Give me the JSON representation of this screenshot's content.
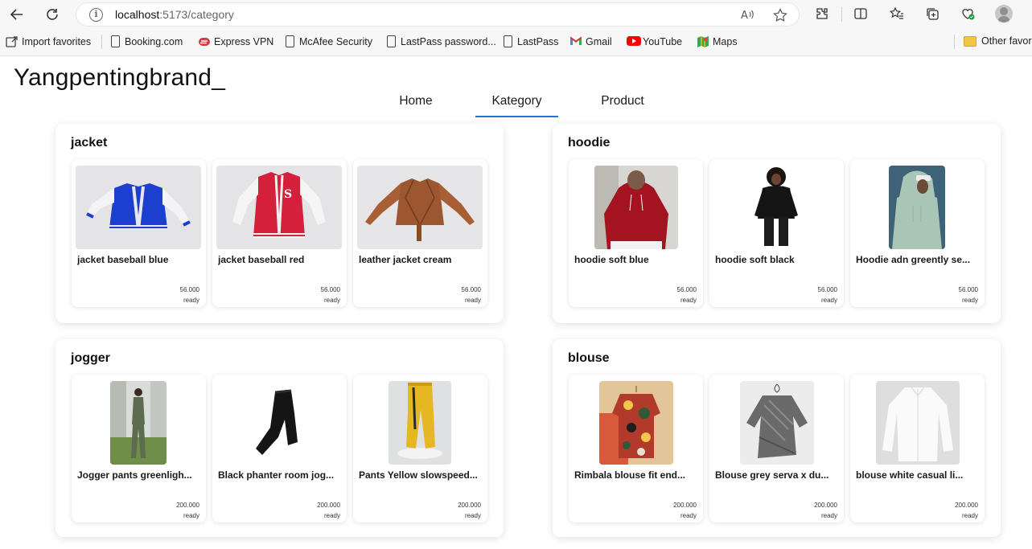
{
  "browser": {
    "url_host": "localhost",
    "url_rest": ":5173/category",
    "bookmarks": [
      {
        "label": "Import favorites",
        "icon": "import-icon"
      },
      {
        "label": "Booking.com",
        "icon": "page-icon"
      },
      {
        "label": "Express VPN",
        "icon": "expressvpn-icon"
      },
      {
        "label": "McAfee Security",
        "icon": "page-icon"
      },
      {
        "label": "LastPass password...",
        "icon": "page-icon"
      },
      {
        "label": "LastPass",
        "icon": "page-icon"
      },
      {
        "label": "Gmail",
        "icon": "gmail-icon"
      },
      {
        "label": "YouTube",
        "icon": "youtube-icon"
      },
      {
        "label": "Maps",
        "icon": "maps-icon"
      },
      {
        "label": "Other favor",
        "icon": "folder-icon"
      }
    ]
  },
  "app": {
    "brand": "Yangpentingbrand_",
    "tabs": [
      {
        "label": "Home",
        "active": false
      },
      {
        "label": "Kategory",
        "active": true
      },
      {
        "label": "Product",
        "active": false
      }
    ],
    "accent_color": "#1976d2"
  },
  "categories": [
    {
      "title": "jacket",
      "items": [
        {
          "name": "jacket baseball blue",
          "price": "56.000",
          "status": "ready",
          "image": "blue-varsity-jacket"
        },
        {
          "name": "jacket baseball red",
          "price": "56.000",
          "status": "ready",
          "image": "red-varsity-jacket"
        },
        {
          "name": "leather jacket cream",
          "price": "56.000",
          "status": "ready",
          "image": "brown-leather-jacket"
        }
      ]
    },
    {
      "title": "hoodie",
      "items": [
        {
          "name": "hoodie soft blue",
          "price": "56.000",
          "status": "ready",
          "image": "red-hoodie-person"
        },
        {
          "name": "hoodie soft black",
          "price": "56.000",
          "status": "ready",
          "image": "black-hoodie-person"
        },
        {
          "name": "Hoodie adn greently se...",
          "price": "56.000",
          "status": "ready",
          "image": "mint-hoodie-person"
        }
      ]
    },
    {
      "title": "jogger",
      "items": [
        {
          "name": "Jogger pants greenligh...",
          "price": "200.000",
          "status": "ready",
          "image": "green-jogger-person"
        },
        {
          "name": "Black phanter room jog...",
          "price": "200.000",
          "status": "ready",
          "image": "black-jogger"
        },
        {
          "name": "Pants Yellow slowspeed...",
          "price": "200.000",
          "status": "ready",
          "image": "yellow-pants"
        }
      ]
    },
    {
      "title": "blouse",
      "items": [
        {
          "name": "Rimbala blouse fit end...",
          "price": "200.000",
          "status": "ready",
          "image": "floral-blouse"
        },
        {
          "name": "Blouse grey serva x du...",
          "price": "200.000",
          "status": "ready",
          "image": "grey-blouse"
        },
        {
          "name": "blouse white casual li...",
          "price": "200.000",
          "status": "ready",
          "image": "white-blouse"
        }
      ]
    }
  ]
}
